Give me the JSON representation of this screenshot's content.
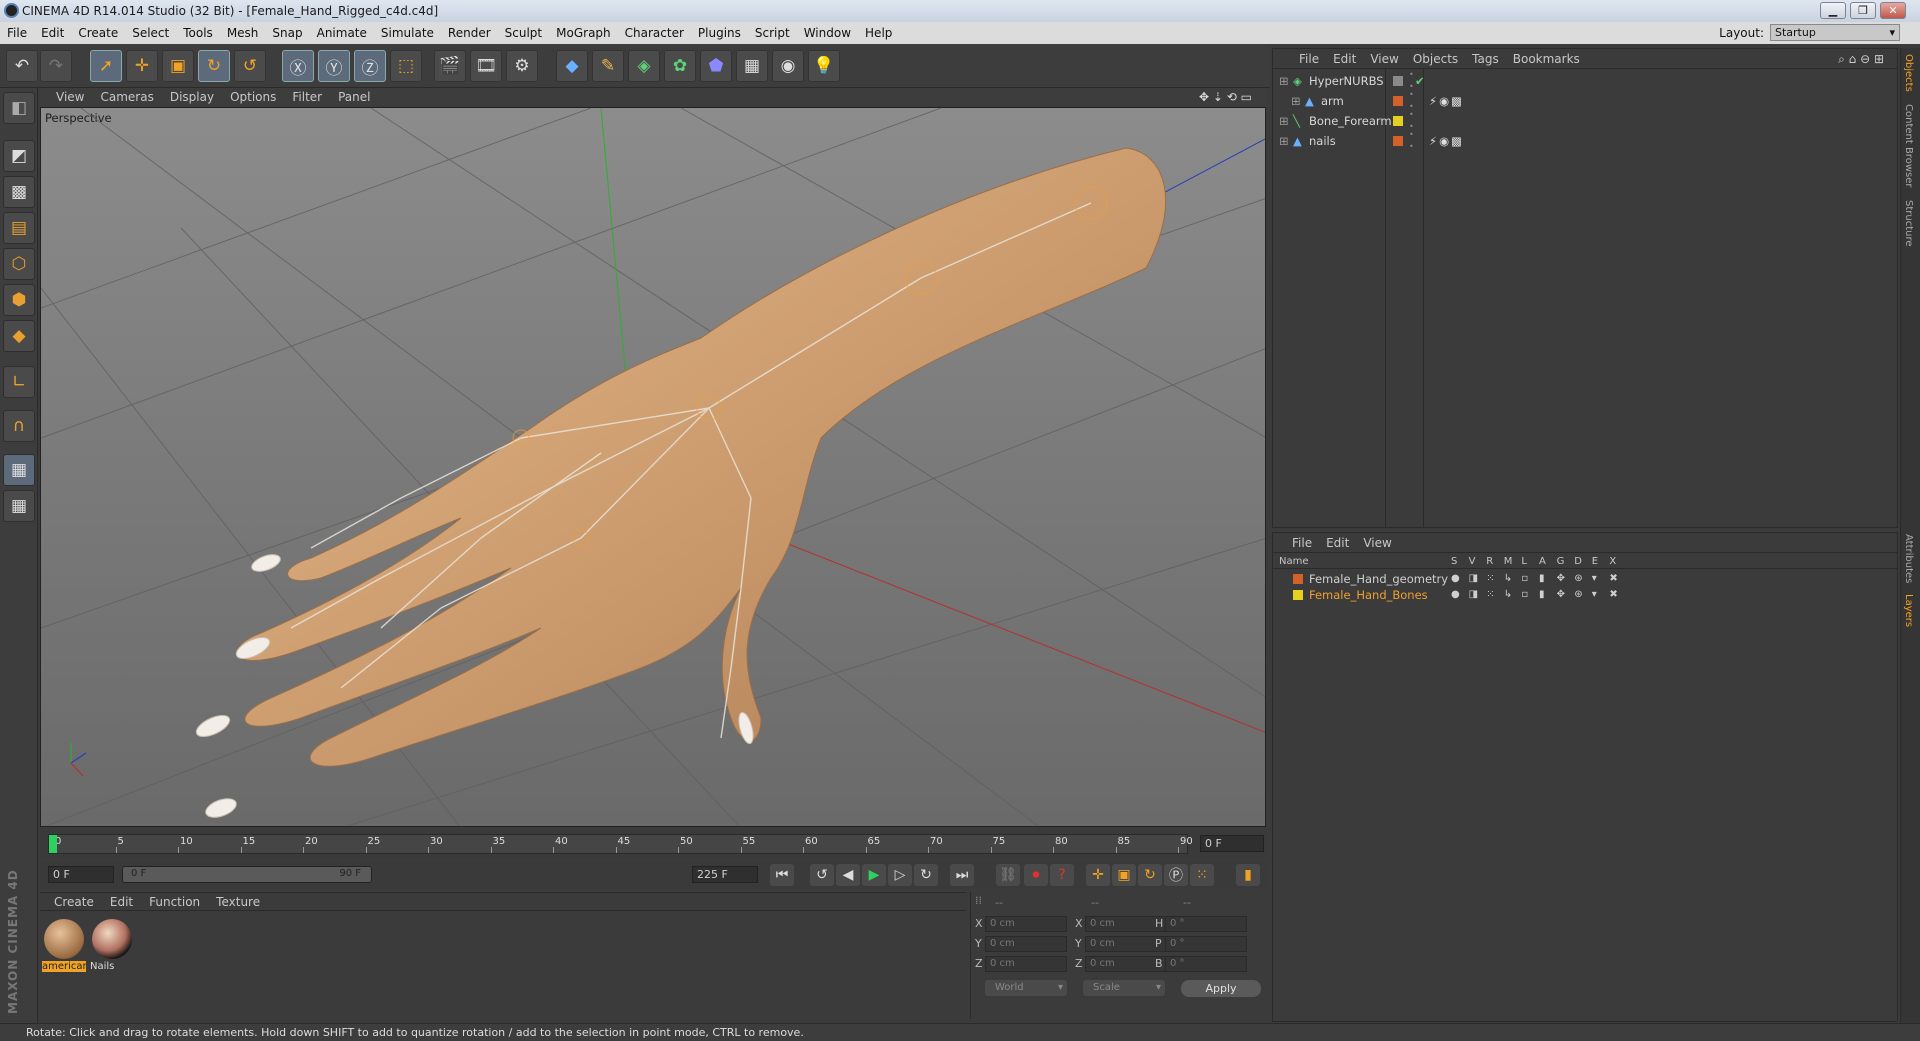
{
  "window": {
    "title": "CINEMA 4D R14.014 Studio (32 Bit) - [Female_Hand_Rigged_c4d.c4d]",
    "min": "▁",
    "max": "❐",
    "close": "✕"
  },
  "menubar": {
    "items": [
      "File",
      "Edit",
      "Create",
      "Select",
      "Tools",
      "Mesh",
      "Snap",
      "Animate",
      "Simulate",
      "Render",
      "Sculpt",
      "MoGraph",
      "Character",
      "Plugins",
      "Script",
      "Window",
      "Help"
    ],
    "layout_label": "Layout:",
    "layout_value": "Startup"
  },
  "viewport": {
    "menu": [
      "View",
      "Cameras",
      "Display",
      "Options",
      "Filter",
      "Panel"
    ],
    "label": "Perspective"
  },
  "timeline": {
    "ticks": [
      "0",
      "5",
      "10",
      "15",
      "20",
      "25",
      "30",
      "35",
      "40",
      "45",
      "50",
      "55",
      "60",
      "65",
      "70",
      "75",
      "80",
      "85",
      "90"
    ],
    "current_frame": "0 F",
    "start_field": "0 F",
    "range_start": "0 F",
    "range_end": "90 F",
    "end_field": "225 F"
  },
  "materials": {
    "menu": [
      "Create",
      "Edit",
      "Function",
      "Texture"
    ],
    "items": [
      {
        "name": "americar",
        "selected": true
      },
      {
        "name": "Nails",
        "selected": false
      }
    ],
    "brand": "MAXON CINEMA 4D"
  },
  "coords": {
    "header_a": "--",
    "header_b": "--",
    "header_c": "--",
    "rows": [
      {
        "a_label": "X",
        "a_val": "0 cm",
        "b_label": "X",
        "b_val": "0 cm",
        "c_label": "H",
        "c_val": "0 °"
      },
      {
        "a_label": "Y",
        "a_val": "0 cm",
        "b_label": "Y",
        "b_val": "0 cm",
        "c_label": "P",
        "c_val": "0 °"
      },
      {
        "a_label": "Z",
        "a_val": "0 cm",
        "b_label": "Z",
        "b_val": "0 cm",
        "c_label": "B",
        "c_val": "0 °"
      }
    ],
    "space": "World",
    "mode": "Scale",
    "apply": "Apply"
  },
  "object_manager": {
    "menu": [
      "File",
      "Edit",
      "View",
      "Objects",
      "Tags",
      "Bookmarks"
    ],
    "objects": [
      {
        "name": "HyperNURBS",
        "indent": 0,
        "color": "#8a8a8a",
        "icon": "hypernurbs-icon"
      },
      {
        "name": "arm",
        "indent": 1,
        "color": "#d2622a",
        "icon": "polygon-icon"
      },
      {
        "name": "Bone_Forearm",
        "indent": 0,
        "color": "#e6d21e",
        "icon": "bone-icon"
      },
      {
        "name": "nails",
        "indent": 0,
        "color": "#d2622a",
        "icon": "polygon-icon"
      }
    ]
  },
  "layer_manager": {
    "menu": [
      "File",
      "Edit",
      "View"
    ],
    "columns": [
      "Name",
      "S",
      "V",
      "R",
      "M",
      "L",
      "A",
      "G",
      "D",
      "E",
      "X"
    ],
    "layers": [
      {
        "name": "Female_Hand_geometry",
        "color": "#d2622a",
        "text_color": "#d0d0d0"
      },
      {
        "name": "Female_Hand_Bones",
        "color": "#e6d21e",
        "text_color": "#f0a030"
      }
    ]
  },
  "side_tabs": [
    "Objects",
    "Content Browser",
    "Structure",
    "Attributes",
    "Layers"
  ],
  "status": "Rotate: Click and drag to rotate elements. Hold down SHIFT to add to quantize rotation / add to the selection in point mode, CTRL to remove."
}
